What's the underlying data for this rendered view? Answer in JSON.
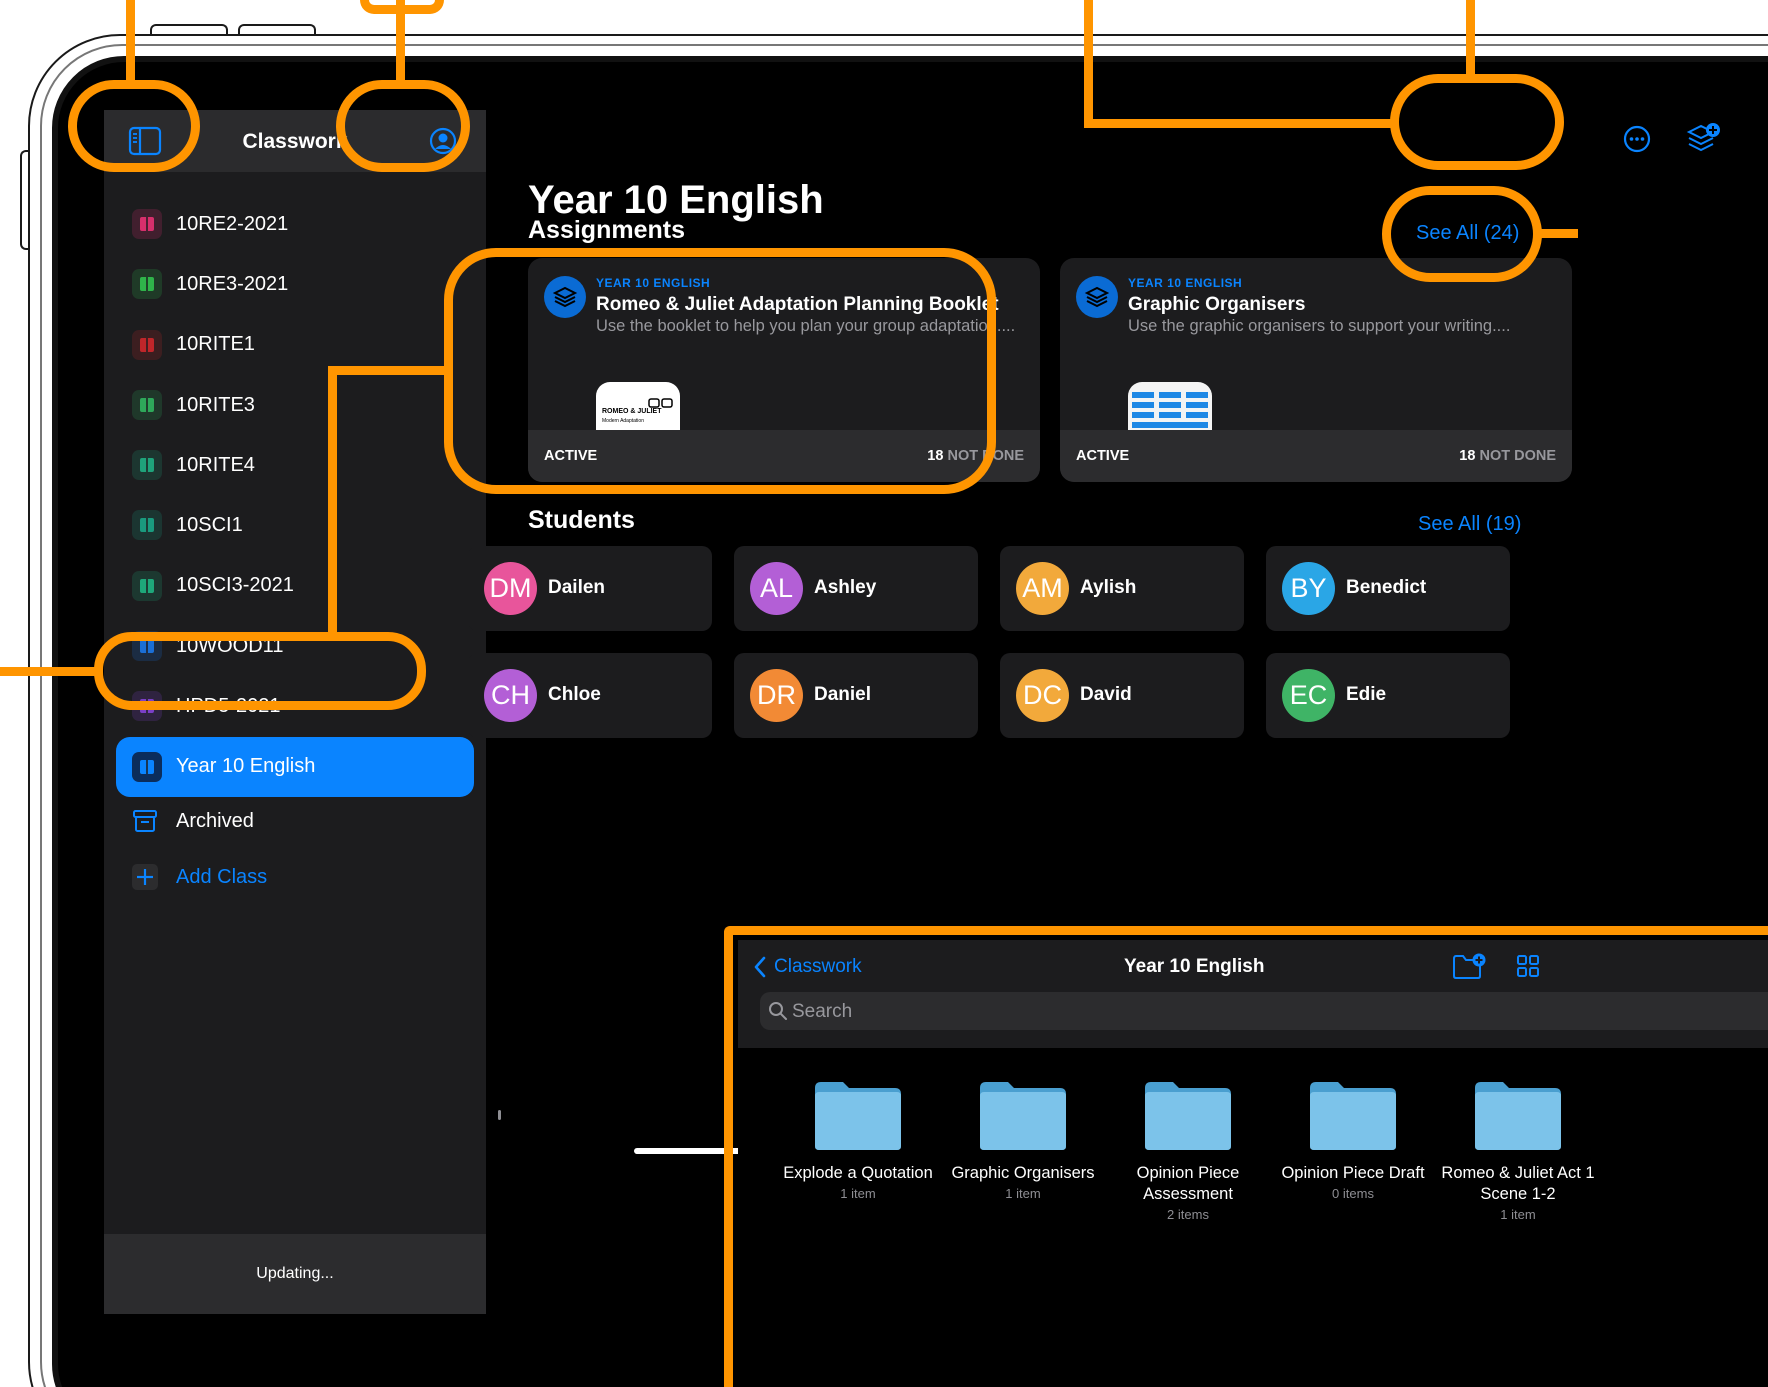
{
  "sidebar": {
    "title": "Classwork",
    "classes": [
      {
        "label": "10RE2-2021",
        "color": "#d62f6c"
      },
      {
        "label": "10RE3-2021",
        "color": "#2fb34a"
      },
      {
        "label": "10RITE1",
        "color": "#c0262a"
      },
      {
        "label": "10RITE3",
        "color": "#2ea85a"
      },
      {
        "label": "10RITE4",
        "color": "#1fa27a"
      },
      {
        "label": "10SCI1",
        "color": "#1a9a7e"
      },
      {
        "label": "10SCI3-2021",
        "color": "#1ea87a"
      },
      {
        "label": "10WOOD11",
        "color": "#1b6fd6"
      },
      {
        "label": "HPD5-2021",
        "color": "#7b3fc8"
      },
      {
        "label": "Year 10 English",
        "color": "#0a84ff"
      }
    ],
    "archived": "Archived",
    "add_class": "Add Class",
    "status": "Updating..."
  },
  "main": {
    "title": "Year 10 English",
    "assignments_heading": "Assignments",
    "assignments_see_all": "See All (24)",
    "assignments": [
      {
        "class": "YEAR 10 ENGLISH",
        "title": "Romeo & Juliet Adaptation Planning Booklet",
        "description": "Use the booklet to help you plan your group adaptation....",
        "status": "ACTIVE",
        "count": "18",
        "count_label": "NOT DONE",
        "thumb_text": "ROMEO & JULIET",
        "thumb_sub": "Modern Adaptation"
      },
      {
        "class": "YEAR 10 ENGLISH",
        "title": "Graphic Organisers",
        "description": "Use the graphic organisers to support your writing....",
        "status": "ACTIVE",
        "count": "18",
        "count_label": "NOT DONE"
      }
    ],
    "students_heading": "Students",
    "students_see_all": "See All (19)",
    "students": [
      {
        "initials": "DM",
        "name": "Dailen",
        "color": "#e8559b"
      },
      {
        "initials": "AL",
        "name": "Ashley",
        "color": "#b35fd6"
      },
      {
        "initials": "AM",
        "name": "Aylish",
        "color": "#f2a93b"
      },
      {
        "initials": "BY",
        "name": "Benedict",
        "color": "#2aa6e6"
      },
      {
        "initials": "CH",
        "name": "Chloe",
        "color": "#b35fd6"
      },
      {
        "initials": "DR",
        "name": "Daniel",
        "color": "#f28a35"
      },
      {
        "initials": "DC",
        "name": "David",
        "color": "#f2a93b"
      },
      {
        "initials": "EC",
        "name": "Edie",
        "color": "#3fb466"
      }
    ]
  },
  "files": {
    "back_label": "Classwork",
    "title": "Year 10 English",
    "search_placeholder": "Search",
    "folders": [
      {
        "name": "Explode a Quotation",
        "count": "1 item"
      },
      {
        "name": "Graphic Organisers",
        "count": "1 item"
      },
      {
        "name": "Opinion Piece Assessment",
        "count": "2 items"
      },
      {
        "name": "Opinion Piece Draft",
        "count": "0 items"
      },
      {
        "name": "Romeo & Juliet Act 1 Scene 1-2",
        "count": "1 item"
      }
    ]
  },
  "colors": {
    "accent": "#0a84ff",
    "annotation": "#ff9500",
    "background": "#000000"
  }
}
